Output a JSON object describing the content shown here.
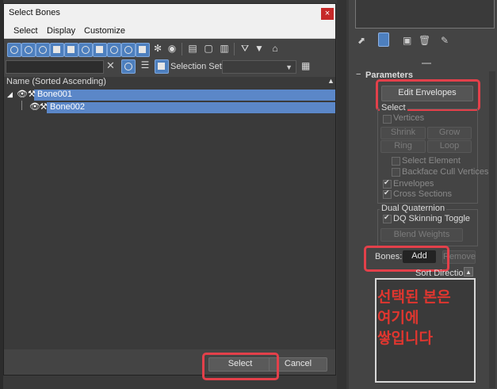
{
  "dialog": {
    "title": "Select Bones",
    "close_glyph": "×",
    "menu": [
      "Select",
      "Display",
      "Customize"
    ],
    "selection_set_label": "Selection Set:",
    "search_placeholder": "",
    "list_header": "Name (Sorted Ascending)",
    "rows": [
      {
        "label": "Bone001",
        "depth": 0,
        "selected": true
      },
      {
        "label": "Bone002",
        "depth": 1,
        "selected": true
      }
    ],
    "buttons": {
      "select": "Select",
      "cancel": "Cancel"
    }
  },
  "panel": {
    "rollout_title": "Parameters",
    "edit_envelopes": "Edit Envelopes",
    "select_group": {
      "title": "Select",
      "vertices": "Vertices",
      "shrink": "Shrink",
      "grow": "Grow",
      "ring": "Ring",
      "loop": "Loop",
      "select_element": "Select Element",
      "backface_cull": "Backface Cull Vertices",
      "envelopes": "Envelopes",
      "cross_sections": "Cross Sections"
    },
    "dq_group": {
      "title": "Dual Quaternion",
      "dq_toggle": "DQ Skinning Toggle",
      "blend_weights": "Blend Weights"
    },
    "bones_label": "Bones:",
    "add": "Add",
    "remove": "Remove",
    "sort_direction": "Sort Direction:",
    "annotation": "선택된 본은\n여기에\n쌓입니다"
  },
  "colors": {
    "highlight": "#e3404a",
    "selection": "#5b87c8"
  }
}
